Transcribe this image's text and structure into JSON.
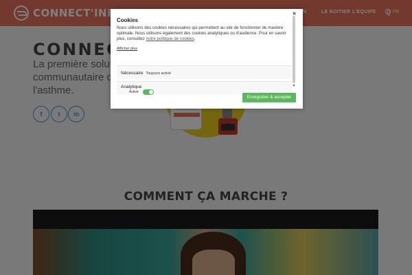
{
  "header": {
    "logo_text": "CONNECT'INH",
    "nav_partial": "ION",
    "nav_items": [
      "LE BOITIER",
      "L'EQUIPE"
    ],
    "lang": "FR"
  },
  "hero": {
    "title": "CONNECT'",
    "subtitle": "La première solution communautaire déd l'asthme.",
    "social": [
      {
        "icon": "facebook-icon",
        "glyph": "f"
      },
      {
        "icon": "twitter-icon",
        "glyph": "t"
      },
      {
        "icon": "linkedin-icon",
        "glyph": "in"
      }
    ]
  },
  "section": {
    "title": "COMMENT ÇA MARCHE ?"
  },
  "cookie_modal": {
    "close_glyph": "×",
    "title": "Cookies",
    "body_text": "Nous utilisons des cookies nécessaires qui permettent au site de fonctionner de manière optimale. Nous utilisons également des cookies analytiques ou d'audience. Pour en savoir plus, consultez ",
    "policy_link": "notre politique de cookies",
    "body_end": ".",
    "more_link": "Afficher plus",
    "categories": [
      {
        "name": "Nécessaire",
        "status": "Toujours activé"
      },
      {
        "name": "Analytique",
        "status": "Activé",
        "enabled": true
      }
    ],
    "save_label": "Enregistrer & accepter"
  },
  "colors": {
    "brand": "#e6705d",
    "accent_green": "#5cb85c",
    "social_blue": "#4a90d9"
  }
}
